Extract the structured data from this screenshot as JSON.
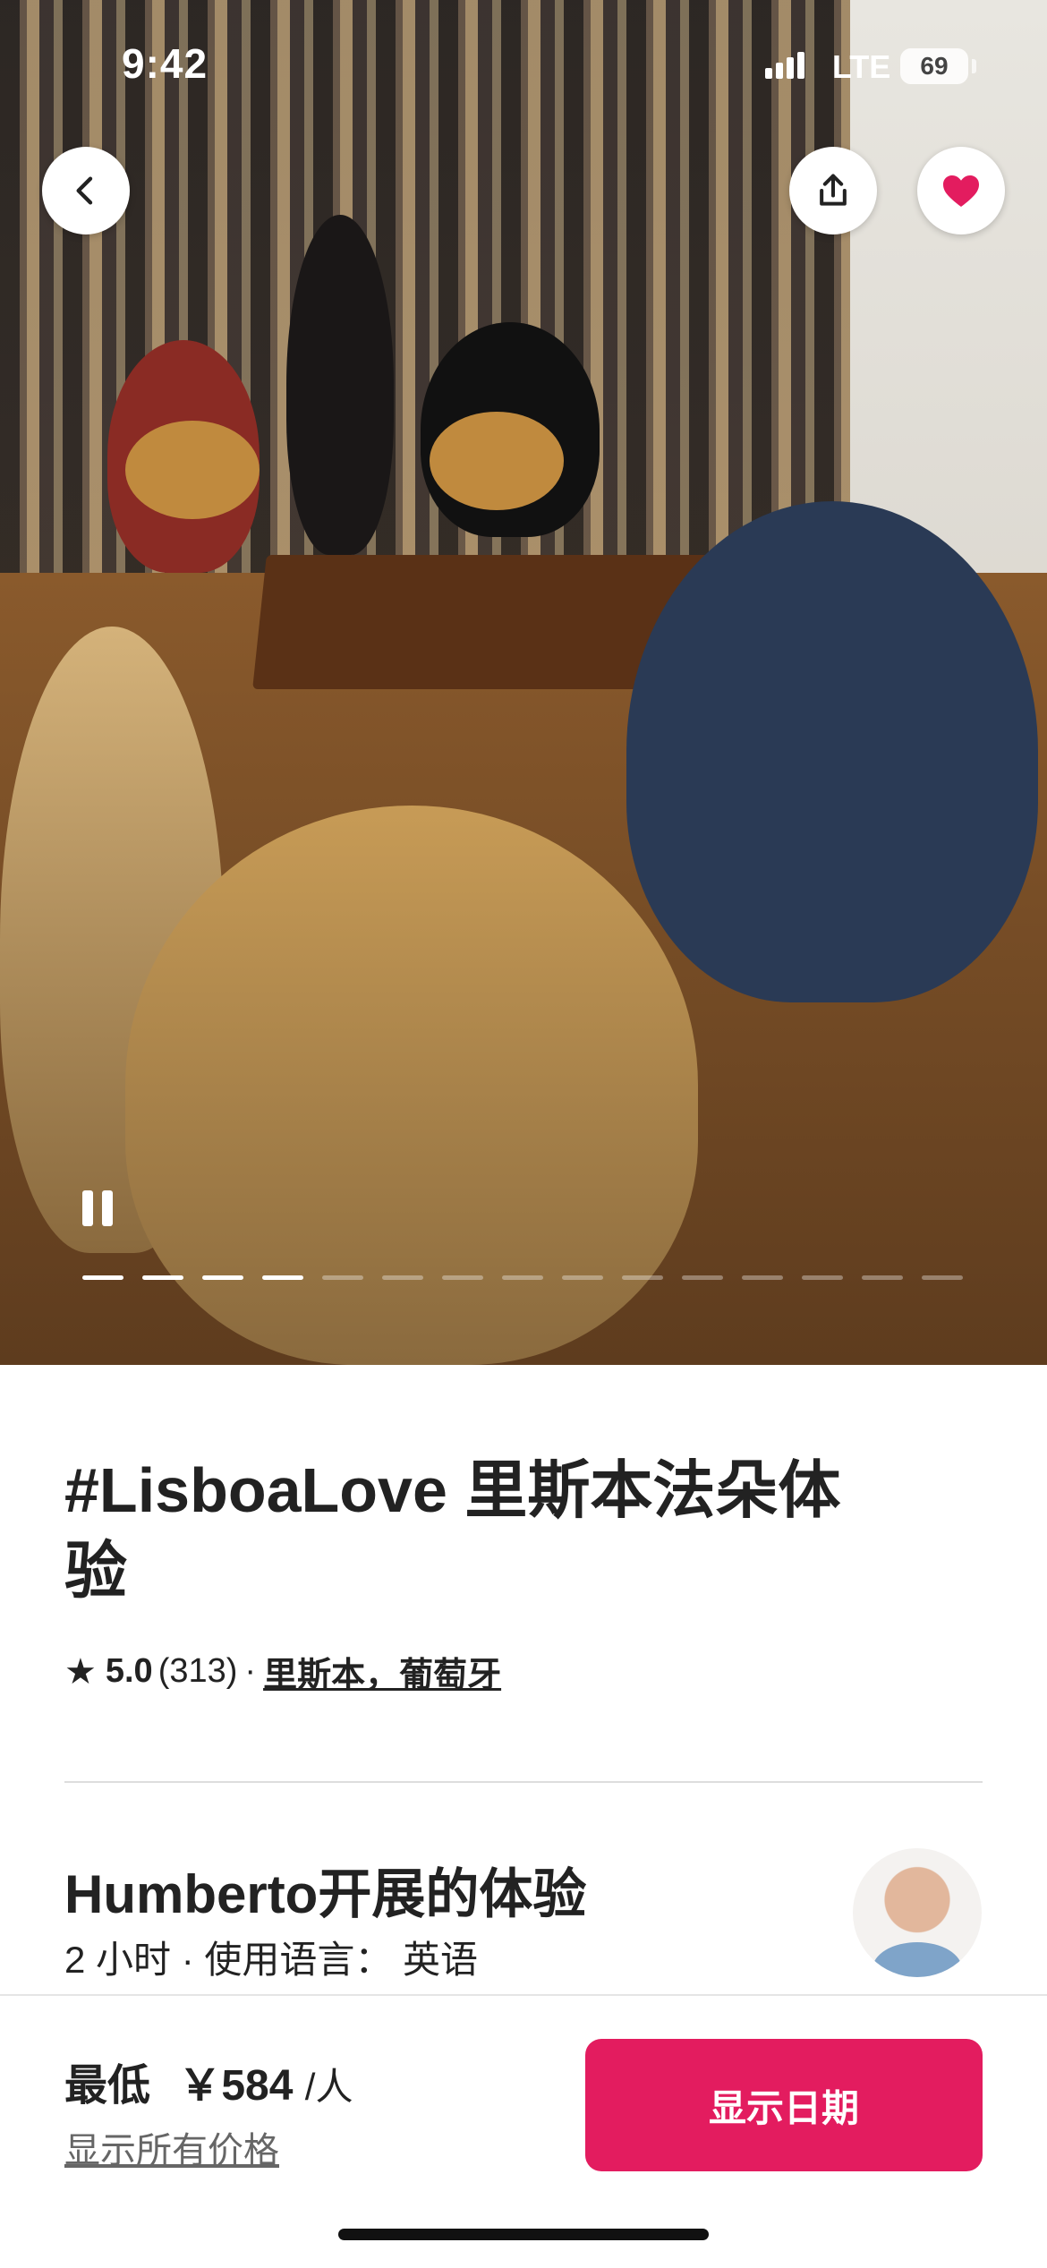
{
  "status_bar": {
    "time": "9:42",
    "network": "LTE",
    "battery": "69"
  },
  "hero": {
    "actions": {
      "back_icon": "chevron-left-icon",
      "share_icon": "share-icon",
      "favorite_icon": "heart-icon"
    },
    "slideshow": {
      "state_icon": "pause-icon",
      "total_slides": 15,
      "active_index": 3
    }
  },
  "listing": {
    "title": "#LisboaLove 里斯本法朵体验",
    "rating": "5.0",
    "reviews": "(313)",
    "separator": "·",
    "location": "里斯本，葡萄牙",
    "host_title": "Humberto开展的体验",
    "details": "2 小时 · 使用语言： 英语"
  },
  "booking": {
    "price_prefix": "最低",
    "price": "￥584",
    "price_unit": "/人",
    "all_prices_link": "显示所有价格",
    "cta_label": "显示日期"
  },
  "colors": {
    "accent": "#E31C5F",
    "text": "#222222"
  }
}
